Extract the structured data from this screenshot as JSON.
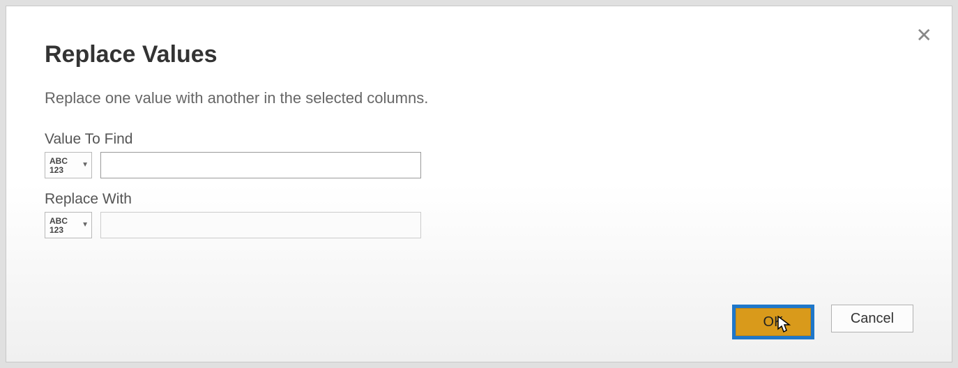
{
  "dialog": {
    "title": "Replace Values",
    "description": "Replace one value with another in the selected columns.",
    "close_glyph": "✕"
  },
  "fields": {
    "find": {
      "label": "Value To Find",
      "type_abc": "ABC",
      "type_123": "123",
      "value": ""
    },
    "replace": {
      "label": "Replace With",
      "type_abc": "ABC",
      "type_123": "123",
      "value": ""
    }
  },
  "buttons": {
    "ok": "OK",
    "cancel": "Cancel"
  }
}
